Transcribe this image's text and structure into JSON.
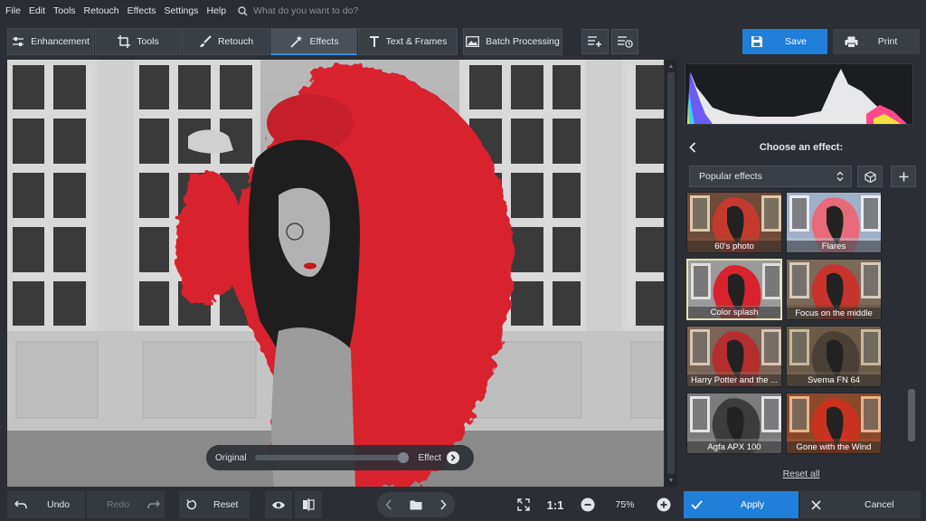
{
  "menu": {
    "items": [
      "File",
      "Edit",
      "Tools",
      "Retouch",
      "Effects",
      "Settings",
      "Help"
    ],
    "search_placeholder": "What do you want to do?"
  },
  "toolbar": {
    "tabs": [
      {
        "label": "Enhancement",
        "icon": "sliders-icon"
      },
      {
        "label": "Tools",
        "icon": "crop-icon"
      },
      {
        "label": "Retouch",
        "icon": "brush-icon"
      },
      {
        "label": "Effects",
        "icon": "magic-wand-icon",
        "active": true
      },
      {
        "label": "Text & Frames",
        "icon": "text-icon"
      },
      {
        "label": "Batch Processing",
        "icon": "image-stack-icon"
      }
    ],
    "save_label": "Save",
    "print_label": "Print"
  },
  "canvas": {
    "slider": {
      "left_label": "Original",
      "right_label": "Effect",
      "value": 0.96
    }
  },
  "panel": {
    "title": "Choose an effect:",
    "category": "Popular effects",
    "effects": [
      {
        "label": "60's photo",
        "style": "sixties"
      },
      {
        "label": "Flares",
        "style": "flares"
      },
      {
        "label": "Color splash",
        "style": "splash",
        "selected": true
      },
      {
        "label": "Focus on the middle",
        "style": "focus"
      },
      {
        "label": "Harry Potter and the ...",
        "style": "potter"
      },
      {
        "label": "Svema FN 64",
        "style": "svema"
      },
      {
        "label": "Agfa APX 100",
        "style": "agfa"
      },
      {
        "label": "Gone with the Wind",
        "style": "wind"
      }
    ],
    "reset_all": "Reset all"
  },
  "bottom": {
    "undo": "Undo",
    "redo": "Redo",
    "reset": "Reset",
    "zoom_one": "1:1",
    "zoom": "75%",
    "apply": "Apply",
    "cancel": "Cancel"
  },
  "colors": {
    "accent": "#1f7fd9",
    "coat_red": "#d8222e",
    "panel_bg": "#2b2f35"
  }
}
